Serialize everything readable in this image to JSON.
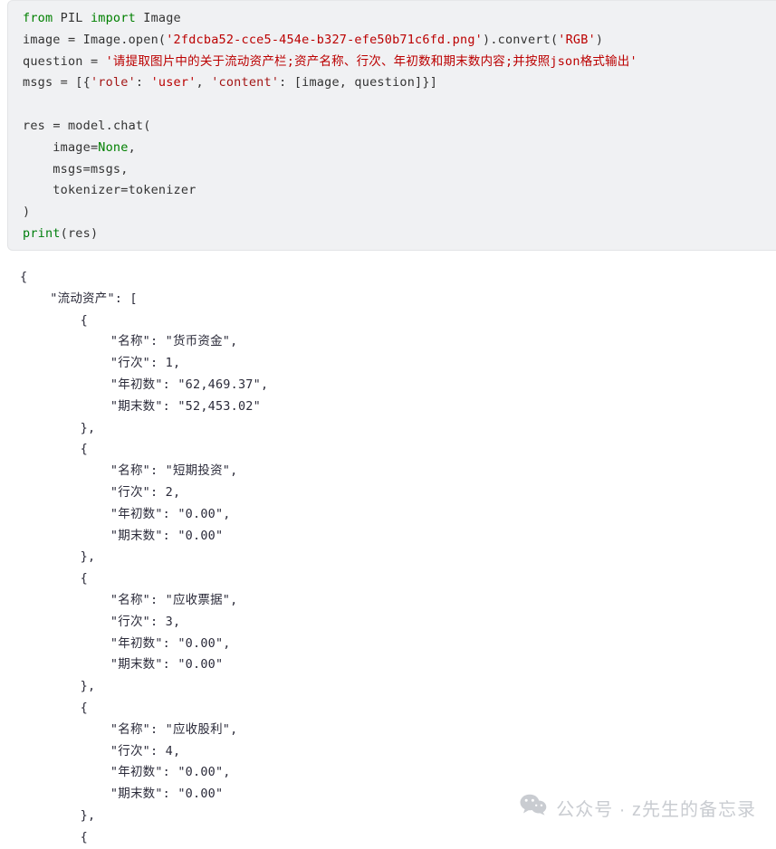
{
  "code_block": {
    "language": "python",
    "lines": [
      [
        {
          "t": "from",
          "c": "kw"
        },
        {
          "t": " PIL ",
          "c": "name"
        },
        {
          "t": "import",
          "c": "kw"
        },
        {
          "t": " Image",
          "c": "name"
        }
      ],
      [
        {
          "t": "image ",
          "c": "name"
        },
        {
          "t": "= ",
          "c": "op"
        },
        {
          "t": "Image",
          "c": "name"
        },
        {
          "t": ".",
          "c": "punc"
        },
        {
          "t": "open",
          "c": "fn"
        },
        {
          "t": "(",
          "c": "punc"
        },
        {
          "t": "'2fdcba52-cce5-454e-b327-efe50b71c6fd.png'",
          "c": "str"
        },
        {
          "t": ")",
          "c": "punc"
        },
        {
          "t": ".",
          "c": "punc"
        },
        {
          "t": "convert",
          "c": "fn"
        },
        {
          "t": "(",
          "c": "punc"
        },
        {
          "t": "'RGB'",
          "c": "str"
        },
        {
          "t": ")",
          "c": "punc"
        }
      ],
      [
        {
          "t": "question ",
          "c": "name"
        },
        {
          "t": "= ",
          "c": "op"
        },
        {
          "t": "'请提取图片中的关于流动资产栏;资产名称、行次、年初数和期末数内容;并按照json格式输出'",
          "c": "cn"
        }
      ],
      [
        {
          "t": "msgs ",
          "c": "name"
        },
        {
          "t": "= ",
          "c": "op"
        },
        {
          "t": "[{",
          "c": "punc"
        },
        {
          "t": "'role'",
          "c": "str-key"
        },
        {
          "t": ": ",
          "c": "punc"
        },
        {
          "t": "'user'",
          "c": "str"
        },
        {
          "t": ", ",
          "c": "punc"
        },
        {
          "t": "'content'",
          "c": "str-key"
        },
        {
          "t": ": ",
          "c": "punc"
        },
        {
          "t": "[image, question]}]",
          "c": "punc"
        }
      ],
      [],
      [
        {
          "t": "res ",
          "c": "name"
        },
        {
          "t": "= ",
          "c": "op"
        },
        {
          "t": "model",
          "c": "name"
        },
        {
          "t": ".",
          "c": "punc"
        },
        {
          "t": "chat",
          "c": "fn"
        },
        {
          "t": "(",
          "c": "punc"
        }
      ],
      [
        {
          "t": "    image=",
          "c": "name"
        },
        {
          "t": "None",
          "c": "kw"
        },
        {
          "t": ",",
          "c": "punc"
        }
      ],
      [
        {
          "t": "    msgs=msgs",
          "c": "name"
        },
        {
          "t": ",",
          "c": "punc"
        }
      ],
      [
        {
          "t": "    tokenizer=tokenizer",
          "c": "name"
        }
      ],
      [
        {
          "t": ")",
          "c": "punc"
        }
      ],
      [
        {
          "t": "print",
          "c": "builtin"
        },
        {
          "t": "(",
          "c": "punc"
        },
        {
          "t": "res",
          "c": "name"
        },
        {
          "t": ")",
          "c": "punc"
        }
      ]
    ]
  },
  "output": {
    "root_key": "流动资产",
    "field_labels": {
      "name": "名称",
      "row": "行次",
      "begin": "年初数",
      "end": "期末数"
    },
    "items": [
      {
        "名称": "货币资金",
        "行次": 1,
        "年初数": "62,469.37",
        "期末数": "52,453.02"
      },
      {
        "名称": "短期投资",
        "行次": 2,
        "年初数": "0.00",
        "期末数": "0.00"
      },
      {
        "名称": "应收票据",
        "行次": 3,
        "年初数": "0.00",
        "期末数": "0.00"
      },
      {
        "名称": "应收股利",
        "行次": 4,
        "年初数": "0.00",
        "期末数": "0.00"
      }
    ],
    "lines": [
      "{",
      "    \"流动资产\": [",
      "        {",
      "            \"名称\": \"货币资金\",",
      "            \"行次\": 1,",
      "            \"年初数\": \"62,469.37\",",
      "            \"期末数\": \"52,453.02\"",
      "        },",
      "        {",
      "            \"名称\": \"短期投资\",",
      "            \"行次\": 2,",
      "            \"年初数\": \"0.00\",",
      "            \"期末数\": \"0.00\"",
      "        },",
      "        {",
      "            \"名称\": \"应收票据\",",
      "            \"行次\": 3,",
      "            \"年初数\": \"0.00\",",
      "            \"期末数\": \"0.00\"",
      "        },",
      "        {",
      "            \"名称\": \"应收股利\",",
      "            \"行次\": 4,",
      "            \"年初数\": \"0.00\",",
      "            \"期末数\": \"0.00\"",
      "        },",
      "        {"
    ]
  },
  "watermark": {
    "icon": "wechat-icon",
    "text": "公众号 · z先生的备忘录"
  },
  "colors": {
    "code_bg": "#f0f1f3",
    "keyword": "#008000",
    "string": "#bb0000",
    "text": "#333333",
    "json_text": "#2b2b3a",
    "watermark": "#c9ccd1"
  }
}
